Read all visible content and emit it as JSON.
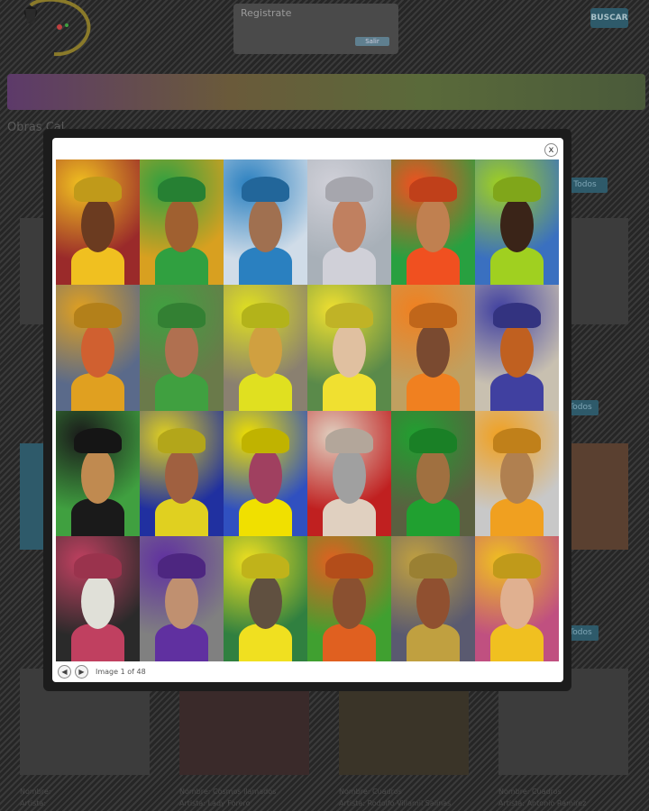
{
  "header": {
    "login_label": "Registrate",
    "login_button": "Salir",
    "search_placeholder": "",
    "search_button": "BUSCAR"
  },
  "page": {
    "section_title": "Obras Cal",
    "tabs": [
      "Todos",
      "Todos",
      "Todos"
    ]
  },
  "cards": [
    {
      "name_label": "Nombre:",
      "name_value": "",
      "artist_label": "Artista:",
      "artist_value": ""
    },
    {
      "name_label": "Nombre:",
      "name_value": "Cosmos llamados",
      "artist_label": "Artista:",
      "artist_value": "Lady Forero"
    },
    {
      "name_label": "Nombre:",
      "name_value": "Cuadros",
      "artist_label": "Artista:",
      "artist_value": "Rodolfo Villamil Salinas"
    },
    {
      "name_label": "Nombre:",
      "name_value": "Cuadros",
      "artist_label": "Artista:",
      "artist_value": "Antonio Ramirez"
    }
  ],
  "lightbox": {
    "close_symbol": "x",
    "prev_symbol": "◀",
    "next_symbol": "▶",
    "counter_text": "Image 1 of 48",
    "photos": [
      {
        "bg": "#9a2a2a",
        "accent": "#f0c020",
        "skin": "#6b3b20"
      },
      {
        "bg": "#d8a020",
        "accent": "#30a040",
        "skin": "#a06030"
      },
      {
        "bg": "#d0dce8",
        "accent": "#2a80c0",
        "skin": "#a07050"
      },
      {
        "bg": "#a8b0b8",
        "accent": "#d0d0d8",
        "skin": "#c08060"
      },
      {
        "bg": "#28a040",
        "accent": "#f05020",
        "skin": "#c08050"
      },
      {
        "bg": "#3a70c0",
        "accent": "#a0d020",
        "skin": "#3a2418"
      },
      {
        "bg": "#5a6a8a",
        "accent": "#e0a020",
        "skin": "#d06030"
      },
      {
        "bg": "#6a7a4a",
        "accent": "#40a040",
        "skin": "#b07050"
      },
      {
        "bg": "#8a8070",
        "accent": "#e0e020",
        "skin": "#d0a040"
      },
      {
        "bg": "#5a8a4a",
        "accent": "#f0e030",
        "skin": "#e0c0a0"
      },
      {
        "bg": "#c0a060",
        "accent": "#f08020",
        "skin": "#7a4a30"
      },
      {
        "bg": "#c8c0b0",
        "accent": "#4040a0",
        "skin": "#c06020"
      },
      {
        "bg": "#40a040",
        "accent": "#1a1a1a",
        "skin": "#c08a50"
      },
      {
        "bg": "#2030a0",
        "accent": "#e0d020",
        "skin": "#a06040"
      },
      {
        "bg": "#3050c0",
        "accent": "#f0e000",
        "skin": "#a04060"
      },
      {
        "bg": "#c02020",
        "accent": "#e0d0c0",
        "skin": "#a0a0a0"
      },
      {
        "bg": "#5a6040",
        "accent": "#20a030",
        "skin": "#a07040"
      },
      {
        "bg": "#c8c8c8",
        "accent": "#f0a020",
        "skin": "#b08050"
      },
      {
        "bg": "#2a2a2a",
        "accent": "#c04060",
        "skin": "#e0e0d8"
      },
      {
        "bg": "#808080",
        "accent": "#6030a0",
        "skin": "#c09070"
      },
      {
        "bg": "#308040",
        "accent": "#f0e020",
        "skin": "#605040"
      },
      {
        "bg": "#40a030",
        "accent": "#e06020",
        "skin": "#8a5030"
      },
      {
        "bg": "#5a5a70",
        "accent": "#c0a040",
        "skin": "#905030"
      },
      {
        "bg": "#c05080",
        "accent": "#f0c020",
        "skin": "#e0b090"
      }
    ]
  }
}
